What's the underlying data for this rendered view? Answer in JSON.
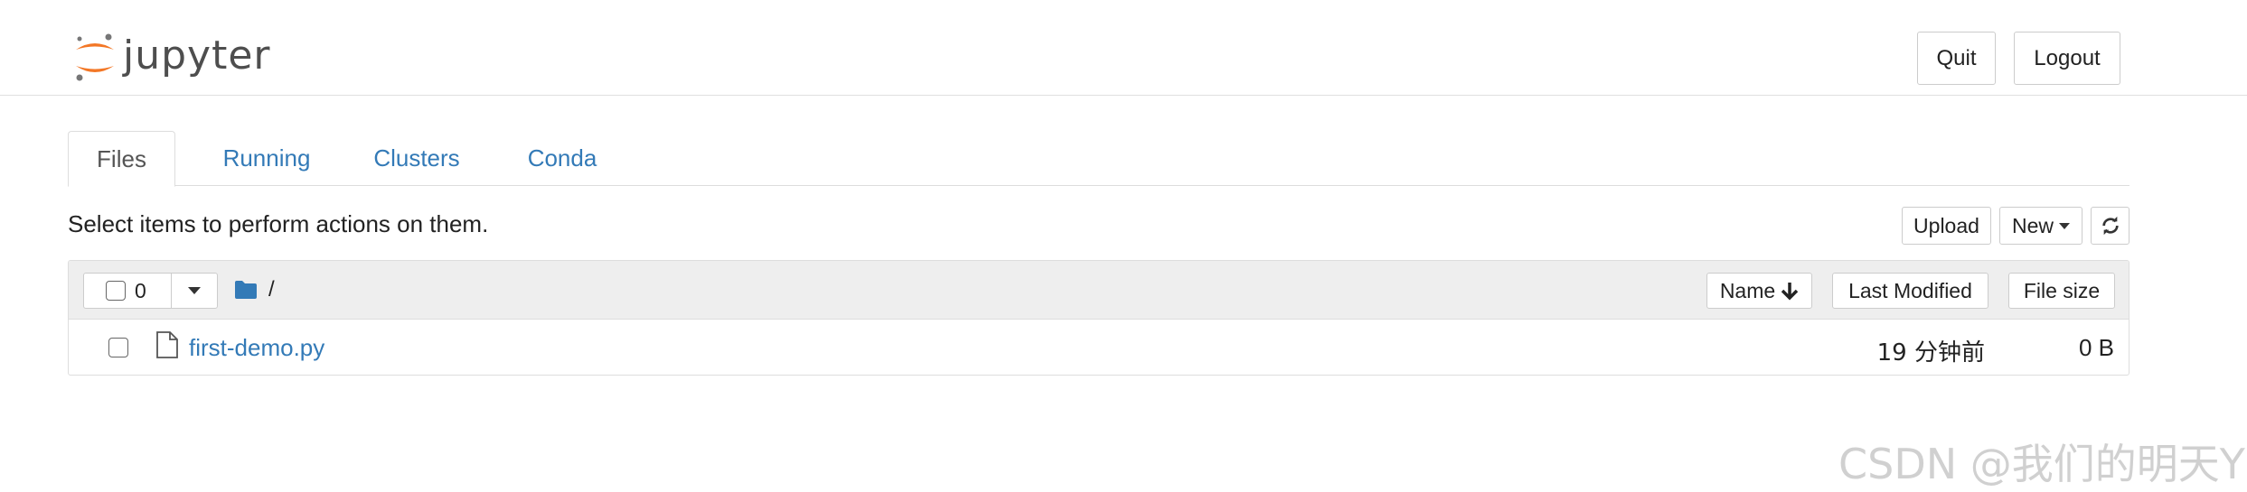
{
  "app": {
    "name": "jupyter",
    "brand_orange": "#f37726",
    "brand_gray": "#767677"
  },
  "header": {
    "quit_label": "Quit",
    "logout_label": "Logout"
  },
  "tabs": [
    {
      "label": "Files",
      "active": true
    },
    {
      "label": "Running",
      "active": false
    },
    {
      "label": "Clusters",
      "active": false
    },
    {
      "label": "Conda",
      "active": false
    }
  ],
  "toolbar": {
    "hint": "Select items to perform actions on them.",
    "upload_label": "Upload",
    "new_label": "New",
    "refresh_icon": "refresh-icon"
  },
  "listing": {
    "selected_count": "0",
    "breadcrumb_icon": "folder-icon",
    "breadcrumb_path": "/",
    "sort": {
      "name_label": "Name",
      "name_icon": "arrow-down-icon",
      "modified_label": "Last Modified",
      "size_label": "File size"
    },
    "files": [
      {
        "icon": "file-icon",
        "name": "first-demo.py",
        "modified": "19 分钟前",
        "size": "0 B"
      }
    ]
  },
  "watermark": "CSDN @我们的明天Y",
  "colors": {
    "link": "#337ab7",
    "header_bg": "#eeeeee",
    "border": "#cccccc"
  }
}
